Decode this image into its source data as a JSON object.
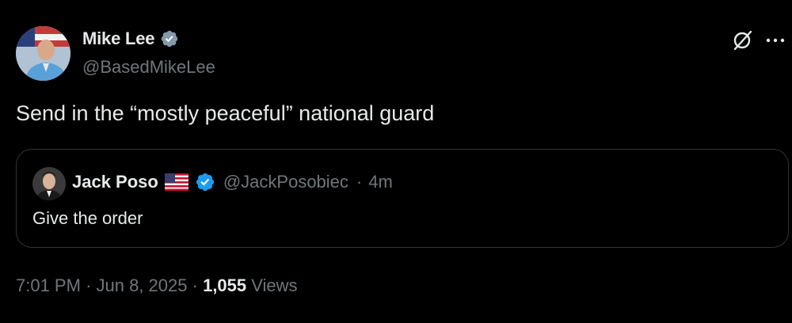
{
  "tweet": {
    "author": {
      "name": "Mike Lee",
      "handle": "@BasedMikeLee",
      "verified": true,
      "badge_color": "#829aab"
    },
    "text": "Send in the “mostly peaceful” national guard",
    "actions": {
      "grok_icon": "grok-icon",
      "more_icon": "more-icon"
    },
    "quoted": {
      "name": "Jack Poso",
      "flag_emoji": "🇺🇸",
      "handle": "@JackPosobiec",
      "separator": "·",
      "time": "4m",
      "verified": true,
      "badge_color": "#1d9bf0",
      "text": "Give the order"
    },
    "meta": {
      "time": "7:01 PM",
      "sep1": "·",
      "date": "Jun 8, 2025",
      "sep2": "·",
      "views_count": "1,055",
      "views_label": "Views"
    }
  },
  "colors": {
    "background": "#000000",
    "text_primary": "#e7e9ea",
    "text_secondary": "#71767b",
    "border": "#2f3336"
  }
}
